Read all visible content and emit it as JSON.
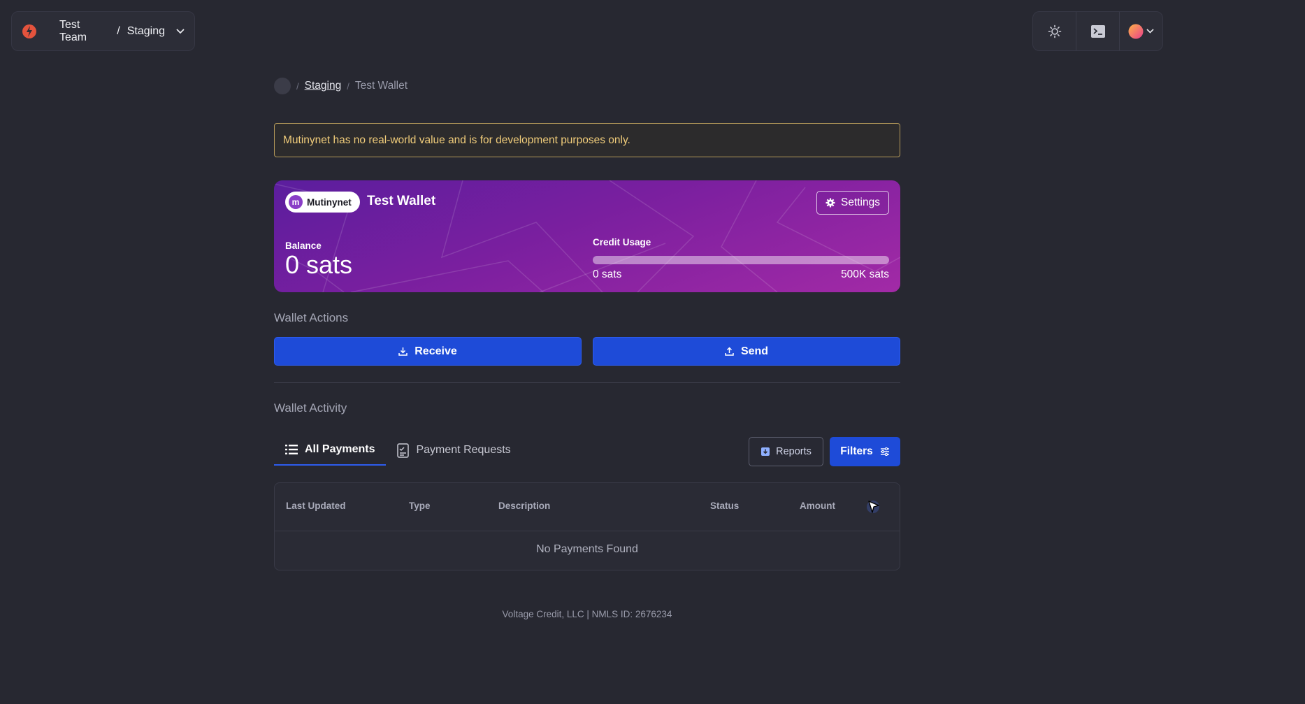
{
  "team_switcher": {
    "team": "Test Team",
    "separator": "/",
    "environment": "Staging"
  },
  "breadcrumb": {
    "link": "Staging",
    "current": "Test Wallet",
    "separator": "/"
  },
  "warning": {
    "text": "Mutinynet has no real-world value and is for development purposes only."
  },
  "wallet": {
    "network": "Mutinynet",
    "network_initial": "m",
    "name": "Test Wallet",
    "settings_label": "Settings",
    "balance_label": "Balance",
    "balance_value": "0 sats",
    "credit_label": "Credit Usage",
    "credit_used": "0 sats",
    "credit_limit": "500K sats",
    "credit_fraction": 0
  },
  "actions": {
    "title": "Wallet Actions",
    "receive": "Receive",
    "send": "Send"
  },
  "activity": {
    "title": "Wallet Activity",
    "tabs": [
      {
        "label": "All Payments"
      },
      {
        "label": "Payment Requests"
      }
    ],
    "reports_label": "Reports",
    "filters_label": "Filters",
    "columns": [
      "Last Updated",
      "Type",
      "Description",
      "Status",
      "Amount"
    ],
    "empty_message": "No Payments Found"
  },
  "footer": {
    "text": "Voltage Credit, LLC | NMLS ID: 2676234"
  },
  "colors": {
    "background": "#272831",
    "primary": "#1e4bd8",
    "warning": "#f0cc7a"
  },
  "icons": [
    "voltage-logo-icon",
    "chevron-down-icon",
    "sun-icon",
    "terminal-icon",
    "avatar-icon",
    "gear-icon",
    "download-icon",
    "upload-icon",
    "list-icon",
    "document-icon",
    "reports-icon",
    "sliders-icon"
  ]
}
